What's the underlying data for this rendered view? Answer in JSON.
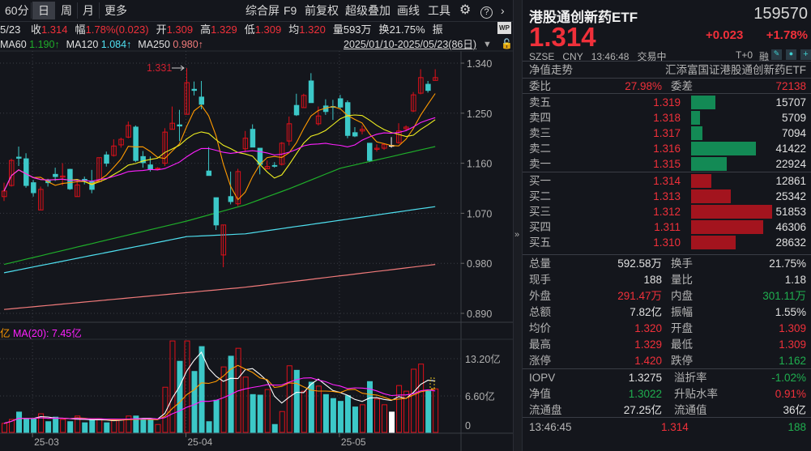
{
  "toolbar": {
    "periods": [
      "60分",
      "日",
      "周",
      "月",
      "更多"
    ],
    "tools": [
      "综合屏",
      "F9",
      "前复权",
      "超级叠加",
      "画线",
      "工具"
    ]
  },
  "info": {
    "date": "5/23",
    "items": [
      {
        "label": "收",
        "value": "1.314"
      },
      {
        "label": "幅",
        "value": "1.78%(0.023)"
      },
      {
        "label": "开",
        "value": "1.309"
      },
      {
        "label": "高",
        "value": "1.329"
      },
      {
        "label": "低",
        "value": "1.309"
      },
      {
        "label": "均",
        "value": "1.320"
      },
      {
        "label": "量",
        "value": "593万"
      },
      {
        "label": "换",
        "value": "21.75%"
      },
      {
        "label": "振",
        "value": ""
      }
    ],
    "wp_badge": "WP"
  },
  "ma_row": {
    "items": [
      {
        "label": "MA60",
        "value": "1.190↑",
        "color": "#1fae2a"
      },
      {
        "label": "MA120",
        "value": "1.084↑",
        "color": "#4fe0f0"
      },
      {
        "label": "MA250",
        "value": "0.980↑",
        "color": "#f07a7a"
      }
    ],
    "date_range": "2025/01/10-2025/05/23(86日)"
  },
  "volume_header": {
    "ma10_fragment": "亿",
    "ma20_label": "MA(20): 7.45亿"
  },
  "chart_data": {
    "type": "candlestick",
    "price_ticks": [
      "1.340",
      "1.250",
      "1.160",
      "1.070",
      "0.980",
      "0.890"
    ],
    "price_range": [
      0.89,
      1.34
    ],
    "max_marker": "1.331",
    "date_ticks": [
      {
        "label": "25-03",
        "index": 4
      },
      {
        "label": "25-04",
        "index": 25
      },
      {
        "label": "25-05",
        "index": 46
      }
    ],
    "candles": [
      [
        1.1,
        1.125,
        1.092,
        1.11
      ],
      [
        1.12,
        1.168,
        1.118,
        1.165
      ],
      [
        1.171,
        1.19,
        1.155,
        1.169
      ],
      [
        1.168,
        1.178,
        1.116,
        1.12
      ],
      [
        1.125,
        1.13,
        1.1,
        1.107
      ],
      [
        1.076,
        1.118,
        1.076,
        1.113
      ],
      [
        1.128,
        1.132,
        1.118,
        1.125
      ],
      [
        1.14,
        1.152,
        1.128,
        1.136
      ],
      [
        1.135,
        1.16,
        1.12,
        1.137
      ],
      [
        1.149,
        1.15,
        1.112,
        1.114
      ],
      [
        1.1,
        1.13,
        1.1,
        1.121
      ],
      [
        1.131,
        1.136,
        1.122,
        1.129
      ],
      [
        1.127,
        1.148,
        1.106,
        1.113
      ],
      [
        1.127,
        1.17,
        1.125,
        1.17
      ],
      [
        1.175,
        1.181,
        1.154,
        1.16
      ],
      [
        1.174,
        1.203,
        1.172,
        1.191
      ],
      [
        1.193,
        1.206,
        1.188,
        1.203
      ],
      [
        1.207,
        1.235,
        1.205,
        1.228
      ],
      [
        1.225,
        1.228,
        1.162,
        1.165
      ],
      [
        1.172,
        1.182,
        1.152,
        1.161
      ],
      [
        1.157,
        1.172,
        1.145,
        1.149
      ],
      [
        1.15,
        1.153,
        1.147,
        1.151
      ],
      [
        1.16,
        1.223,
        1.155,
        1.216
      ],
      [
        1.221,
        1.262,
        1.221,
        1.232
      ],
      [
        1.229,
        1.256,
        1.2,
        1.227
      ],
      [
        1.248,
        1.331,
        1.248,
        1.305
      ],
      [
        1.293,
        1.307,
        1.282,
        1.291
      ],
      [
        1.279,
        1.308,
        1.257,
        1.266
      ],
      [
        1.146,
        1.189,
        1.138,
        1.138
      ],
      [
        1.098,
        1.098,
        1.04,
        1.049
      ],
      [
        0.995,
        1.049,
        0.973,
        1.049
      ],
      [
        1.1,
        1.145,
        1.086,
        1.091
      ],
      [
        1.087,
        1.15,
        1.083,
        1.145
      ],
      [
        1.186,
        1.218,
        1.18,
        1.205
      ],
      [
        1.221,
        1.23,
        1.189,
        1.189
      ],
      [
        1.187,
        1.187,
        1.14,
        1.158
      ],
      [
        1.15,
        1.165,
        1.149,
        1.154
      ],
      [
        1.156,
        1.162,
        1.152,
        1.155
      ],
      [
        1.158,
        1.198,
        1.156,
        1.196
      ],
      [
        1.2,
        1.244,
        1.192,
        1.231
      ],
      [
        1.264,
        1.285,
        1.245,
        1.247
      ],
      [
        1.26,
        1.285,
        1.26,
        1.282
      ],
      [
        1.308,
        1.322,
        1.269,
        1.269
      ],
      [
        1.231,
        1.262,
        1.228,
        1.245
      ],
      [
        1.263,
        1.275,
        1.247,
        1.253
      ],
      [
        1.262,
        1.274,
        1.238,
        1.261
      ],
      [
        1.276,
        1.283,
        1.258,
        1.261
      ],
      [
        1.269,
        1.273,
        1.205,
        1.21
      ],
      [
        1.215,
        1.225,
        1.207,
        1.209
      ],
      [
        1.218,
        1.228,
        1.212,
        1.221
      ],
      [
        1.196,
        1.196,
        1.163,
        1.165
      ],
      [
        1.185,
        1.194,
        1.181,
        1.187
      ],
      [
        1.187,
        1.196,
        1.184,
        1.194
      ],
      [
        1.192,
        1.207,
        1.188,
        1.192
      ],
      [
        1.197,
        1.232,
        1.195,
        1.218
      ],
      [
        1.222,
        1.228,
        1.218,
        1.225
      ],
      [
        1.254,
        1.288,
        1.252,
        1.283
      ],
      [
        1.286,
        1.329,
        1.284,
        1.314
      ],
      [
        1.302,
        1.308,
        1.287,
        1.291
      ],
      [
        1.309,
        1.329,
        1.309,
        1.314
      ]
    ],
    "long_ma": [
      {
        "name": "MA60",
        "color": "#1fae2a",
        "anchors": [
          [
            0,
            0.978
          ],
          [
            25,
            1.056
          ],
          [
            33,
            1.085
          ],
          [
            39,
            1.114
          ],
          [
            46,
            1.151
          ],
          [
            59,
            1.19
          ]
        ]
      },
      {
        "name": "MA120",
        "color": "#4fe0f0",
        "anchors": [
          [
            0,
            0.963
          ],
          [
            25,
            1.028
          ],
          [
            33,
            1.033
          ],
          [
            59,
            1.082
          ]
        ]
      },
      {
        "name": "MA250",
        "color": "#f07a7a",
        "anchors": [
          [
            0,
            0.897
          ],
          [
            33,
            0.937
          ],
          [
            59,
            0.978
          ]
        ]
      }
    ],
    "short_ma": [
      {
        "name": "MA5",
        "period": 5,
        "color": "#ff9a00"
      },
      {
        "name": "MA10",
        "period": 10,
        "color": "#f0f020"
      },
      {
        "name": "MA20",
        "period": 20,
        "color": "#ff20ff"
      }
    ],
    "volume_ticks": [
      "13.20亿",
      "6.60亿",
      "0"
    ],
    "volume_max": 16.5,
    "volume": [
      1.6,
      2.3,
      3.6,
      2.4,
      2.4,
      3.3,
      1.9,
      2.7,
      2.3,
      1.9,
      2.9,
      1.7,
      2.3,
      2.4,
      1.7,
      2.2,
      2.2,
      2.9,
      2.9,
      2.2,
      2.3,
      1.4,
      8.0,
      16.2,
      12.6,
      16.2,
      10.8,
      15.2,
      1.9,
      5.7,
      11.6,
      13.5,
      14.9,
      9.8,
      6.7,
      6.6,
      7.6,
      1.4,
      3.7,
      11.8,
      11.0,
      7.3,
      8.9,
      8.2,
      6.7,
      6.0,
      5.5,
      6.5,
      4.5,
      4.9,
      9.0,
      5.9,
      4.9,
      3.6,
      8.3,
      7.3,
      11.2,
      12.1,
      7.3,
      7.7
    ],
    "volume_ma": [
      {
        "name": "VMA5",
        "period": 5,
        "color": "#ffffff"
      },
      {
        "name": "VMA10",
        "period": 10,
        "color": "#ff9a00"
      },
      {
        "name": "VMA20",
        "period": 20,
        "color": "#ff20ff"
      }
    ],
    "colors": {
      "up": "#e0101a",
      "down": "#3cc8c8"
    }
  },
  "quote": {
    "name": "港股通创新药ETF",
    "code": "159570",
    "price": "1.314",
    "change": "+0.023",
    "change_pct": "+1.78%",
    "exchange": "SZSE",
    "currency": "CNY",
    "time": "13:46:48",
    "status": "交易中",
    "t0": "T+0",
    "margin": "融",
    "nav_trend": "净值走势",
    "full_name": "汇添富国证港股通创新药ETF",
    "weibi_label": "委比",
    "weibi": "27.98%",
    "weicha_label": "委差",
    "weicha": "72138",
    "sell": [
      {
        "label": "卖五",
        "price": "1.319",
        "vol": "15707",
        "n": 15707
      },
      {
        "label": "卖四",
        "price": "1.318",
        "vol": "5709",
        "n": 5709
      },
      {
        "label": "卖三",
        "price": "1.317",
        "vol": "7094",
        "n": 7094
      },
      {
        "label": "卖二",
        "price": "1.316",
        "vol": "41422",
        "n": 41422
      },
      {
        "label": "卖一",
        "price": "1.315",
        "vol": "22924",
        "n": 22924
      }
    ],
    "buy": [
      {
        "label": "买一",
        "price": "1.314",
        "vol": "12861",
        "n": 12861
      },
      {
        "label": "买二",
        "price": "1.313",
        "vol": "25342",
        "n": 25342
      },
      {
        "label": "买三",
        "price": "1.312",
        "vol": "51853",
        "n": 51853
      },
      {
        "label": "买四",
        "price": "1.311",
        "vol": "46306",
        "n": 46306
      },
      {
        "label": "买五",
        "price": "1.310",
        "vol": "28632",
        "n": 28632
      }
    ],
    "stats": [
      {
        "l": "总量",
        "lv": "592.58万",
        "lc": "white",
        "r": "换手",
        "rv": "21.75%",
        "rc": "white"
      },
      {
        "l": "现手",
        "lv": "188",
        "lc": "white",
        "r": "量比",
        "rv": "1.18",
        "rc": "white"
      },
      {
        "l": "外盘",
        "lv": "291.47万",
        "lc": "red",
        "r": "内盘",
        "rv": "301.11万",
        "rc": "green"
      },
      {
        "l": "总额",
        "lv": "7.82亿",
        "lc": "white",
        "r": "振幅",
        "rv": "1.55%",
        "rc": "white"
      },
      {
        "l": "均价",
        "lv": "1.320",
        "lc": "red",
        "r": "开盘",
        "rv": "1.309",
        "rc": "red"
      },
      {
        "l": "最高",
        "lv": "1.329",
        "lc": "red",
        "r": "最低",
        "rv": "1.309",
        "rc": "red"
      },
      {
        "l": "涨停",
        "lv": "1.420",
        "lc": "red",
        "r": "跌停",
        "rv": "1.162",
        "rc": "green"
      }
    ],
    "fund": [
      {
        "l": "IOPV",
        "lv": "1.3275",
        "lc": "white",
        "r": "溢折率",
        "rv": "-1.02%",
        "rc": "green"
      },
      {
        "l": "净值",
        "lv": "1.3022",
        "lc": "green",
        "r": "升贴水率",
        "rv": "0.91%",
        "rc": "red"
      },
      {
        "l": "流通盘",
        "lv": "27.25亿",
        "lc": "white",
        "r": "流通值",
        "rv": "36亿",
        "rc": "white"
      }
    ],
    "tick": {
      "time": "13:46:45",
      "price": "1.314",
      "vol": "188"
    }
  }
}
